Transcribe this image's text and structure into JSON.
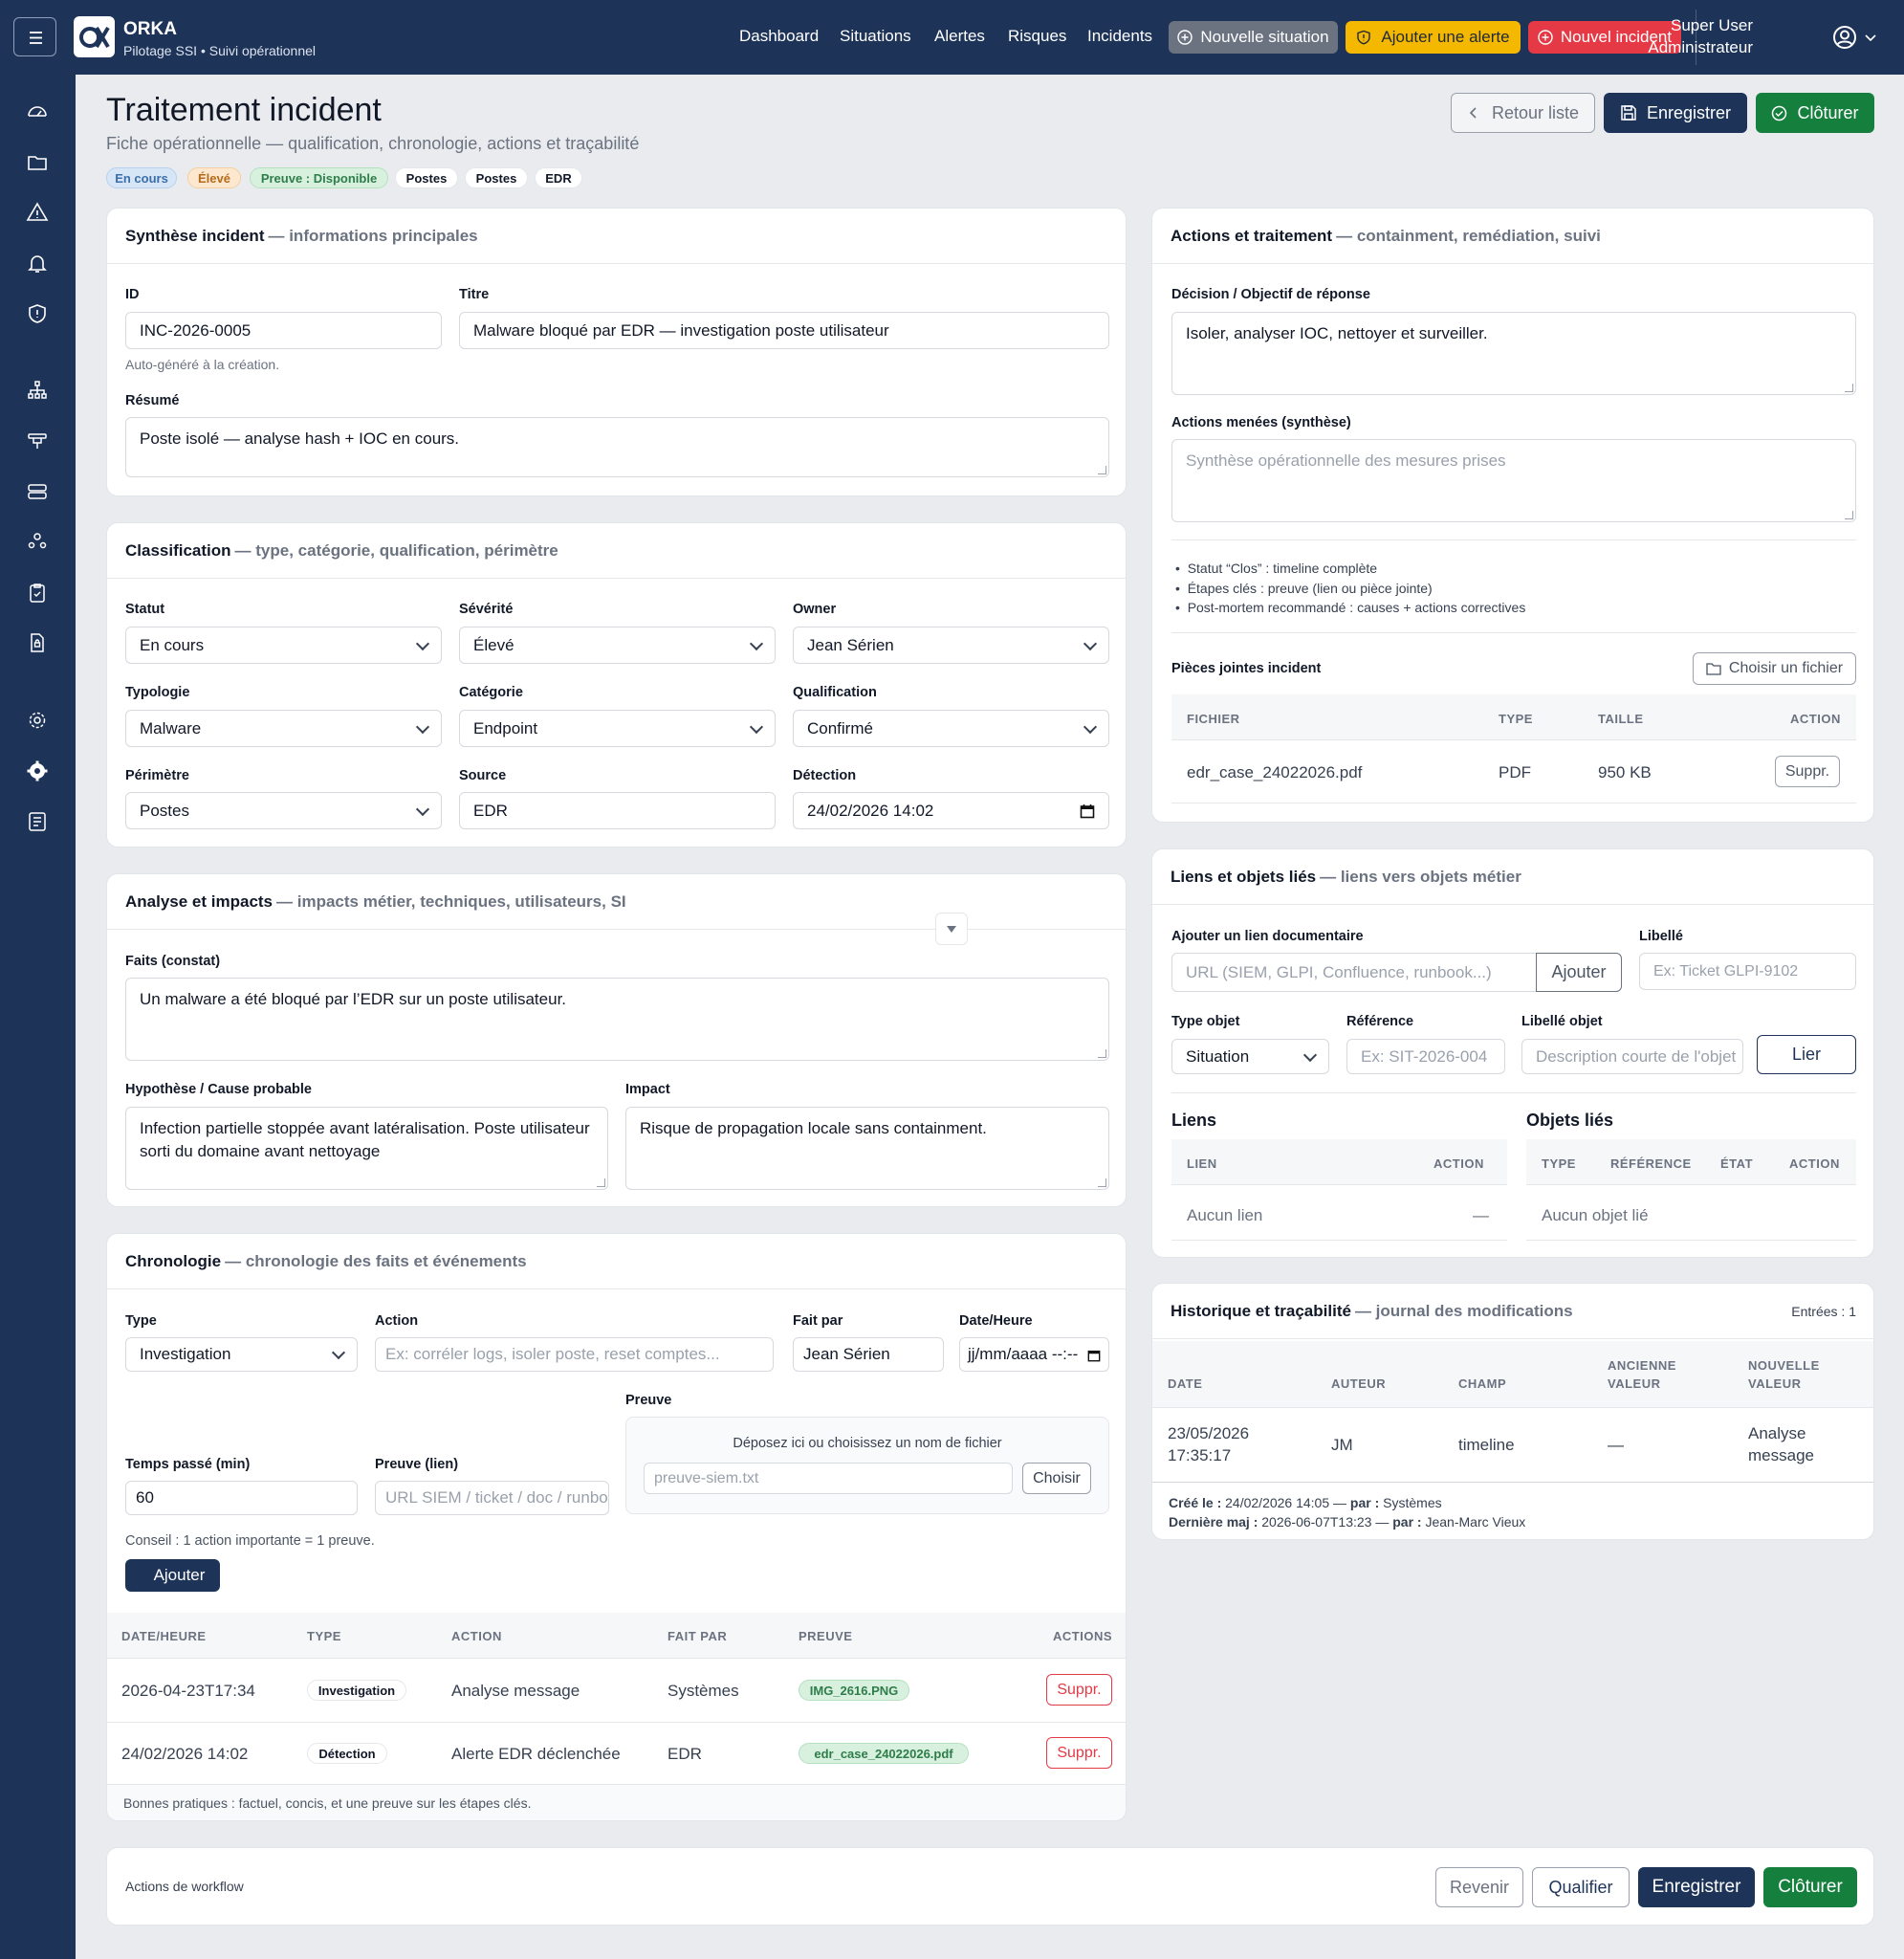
{
  "app": {
    "name": "ORKA",
    "tagline": "Pilotage SSI • Suivi opérationnel"
  },
  "nav": {
    "dashboard": "Dashboard",
    "situations": "Situations",
    "alertes": "Alertes",
    "risques": "Risques",
    "incidents": "Incidents"
  },
  "nav_actions": {
    "new_situation": "Nouvelle situation",
    "add_alert": "Ajouter une alerte",
    "new_incident": "Nouvel incident"
  },
  "user": {
    "name": "Super User",
    "role": "Administrateur"
  },
  "page": {
    "title": "Traitement incident",
    "subtitle": "Fiche opérationnelle — qualification, chronologie, actions et traçabilité",
    "back": "Retour liste",
    "save": "Enregistrer",
    "close": "Clôturer",
    "badges": [
      "En cours",
      "Élevé",
      "Preuve : Disponible",
      "Postes",
      "Postes",
      "EDR"
    ]
  },
  "synthese": {
    "title": "Synthèse incident",
    "sub": "— informations principales",
    "id_label": "ID",
    "id_value": "INC-2026-0005",
    "id_help": "Auto-généré à la création.",
    "title_label": "Titre",
    "title_value": "Malware bloqué par EDR — investigation poste utilisateur",
    "resume_label": "Résumé",
    "resume_value": "Poste isolé — analyse hash + IOC en cours."
  },
  "classification": {
    "title": "Classification",
    "sub": "— type, catégorie, qualification, périmètre",
    "statut_label": "Statut",
    "statut_value": "En cours",
    "severite_label": "Sévérité",
    "severite_value": "Élevé",
    "owner_label": "Owner",
    "owner_value": "Jean Sérien",
    "typologie_label": "Typologie",
    "typologie_value": "Malware",
    "categorie_label": "Catégorie",
    "categorie_value": "Endpoint",
    "qualification_label": "Qualification",
    "qualification_value": "Confirmé",
    "perimetre_label": "Périmètre",
    "perimetre_value": "Postes",
    "source_label": "Source",
    "source_value": "EDR",
    "detection_label": "Détection",
    "detection_value": "24/02/2026 14:02"
  },
  "analyse": {
    "title": "Analyse et impacts",
    "sub": "— impacts métier, techniques, utilisateurs, SI",
    "faits_label": "Faits (constat)",
    "faits_value": "Un malware a été bloqué par l’EDR sur un poste utilisateur.",
    "hypo_label": "Hypothèse / Cause probable",
    "hypo_line1": "Infection partielle stoppée avant latéralisation. Poste utilisateur",
    "hypo_line2": "sorti du domaine avant nettoyage",
    "impact_label": "Impact",
    "impact_value": "Risque de propagation locale sans containment."
  },
  "chrono": {
    "title": "Chronologie",
    "sub": "— chronologie des faits et événements",
    "type_label": "Type",
    "type_value": "Investigation",
    "action_label": "Action",
    "action_placeholder": "Ex: corréler logs, isoler poste, reset comptes...",
    "fait_par_label": "Fait par",
    "fait_par_value": "Jean Sérien",
    "date_label": "Date/Heure",
    "date_placeholder": "jj/mm/aaaa --:--",
    "preuve_label": "Preuve",
    "drop_text": "Déposez ici ou choisissez un nom de fichier",
    "drop_placeholder": "preuve-siem.txt",
    "choose": "Choisir",
    "temps_label": "Temps passé (min)",
    "temps_value": "60",
    "preuve_lien_label": "Preuve (lien)",
    "preuve_lien_placeholder": "URL SIEM / ticket / doc / runbook",
    "tip": "Conseil : 1 action importante = 1 preuve.",
    "add": "Ajouter",
    "columns": [
      "DATE/HEURE",
      "TYPE",
      "ACTION",
      "FAIT PAR",
      "PREUVE",
      "ACTIONS"
    ],
    "rows": [
      {
        "date": "2026-04-23T17:34",
        "type": "Investigation",
        "action": "Analyse message",
        "by": "Systèmes",
        "preuve": "IMG_2616.PNG",
        "del": "Suppr."
      },
      {
        "date": "24/02/2026 14:02",
        "type": "Détection",
        "action": "Alerte EDR déclenchée",
        "by": "EDR",
        "preuve": "edr_case_24022026.pdf",
        "del": "Suppr."
      }
    ],
    "footer": "Bonnes pratiques : factuel, concis, et une preuve sur les étapes clés."
  },
  "actions": {
    "title": "Actions et traitement",
    "sub": "— containment, remédiation, suivi",
    "decision_label": "Décision / Objectif de réponse",
    "decision_value": "Isoler, analyser IOC, nettoyer et surveiller.",
    "menees_label": "Actions menées (synthèse)",
    "menees_placeholder": "Synthèse opérationnelle des mesures prises",
    "bullets": [
      "Statut “Clos” : timeline complète",
      "Étapes clés : preuve (lien ou pièce jointe)",
      "Post-mortem recommandé : causes + actions correctives"
    ],
    "pj_label": "Pièces jointes incident",
    "choose_file": "Choisir un fichier",
    "columns": [
      "FICHIER",
      "TYPE",
      "TAILLE",
      "ACTION"
    ],
    "files": [
      {
        "name": "edr_case_24022026.pdf",
        "type": "PDF",
        "size": "950 KB",
        "del": "Suppr."
      }
    ]
  },
  "liens": {
    "title": "Liens et objets liés",
    "sub": "— liens vers objets métier",
    "add_label": "Ajouter un lien documentaire",
    "url_placeholder": "URL (SIEM, GLPI, Confluence, runbook...)",
    "add_btn": "Ajouter",
    "libelle_label": "Libellé",
    "libelle_placeholder": "Ex: Ticket GLPI-9102",
    "type_obj_label": "Type objet",
    "type_obj_value": "Situation",
    "ref_label": "Référence",
    "ref_placeholder": "Ex: SIT-2026-004",
    "lib_obj_label": "Libellé objet",
    "lib_obj_placeholder": "Description courte de l'objet",
    "lier": "Lier",
    "liens_title": "Liens",
    "liens_columns": [
      "LIEN",
      "ACTION"
    ],
    "liens_empty": "Aucun lien",
    "liens_empty_action": "—",
    "objets_title": "Objets liés",
    "objets_columns": [
      "TYPE",
      "RÉFÉRENCE",
      "ÉTAT",
      "ACTION"
    ],
    "objets_empty": "Aucun objet lié"
  },
  "historique": {
    "title": "Historique et traçabilité",
    "sub": "— journal des modifications",
    "count": "Entrées : 1",
    "columns": [
      "DATE",
      "AUTEUR",
      "CHAMP",
      "ANCIENNE",
      "VALEUR",
      "NOUVELLE",
      "VALEUR"
    ],
    "row": {
      "date1": "23/05/2026",
      "date2": "17:35:17",
      "author": "JM",
      "field": "timeline",
      "old": "—",
      "new1": "Analyse",
      "new2": "message"
    },
    "created_label": "Créé le :",
    "created_value": "24/02/2026 14:05 —",
    "created_by_label": "par :",
    "created_by": "Systèmes",
    "updated_label": "Dernière maj :",
    "updated_value": "2026-06-07T13:23 —",
    "updated_by_label": "par :",
    "updated_by": "Jean-Marc Vieux"
  },
  "workflow": {
    "label": "Actions de workflow",
    "revenir": "Revenir",
    "qualifier": "Qualifier",
    "save": "Enregistrer",
    "close": "Clôturer"
  },
  "colors": {
    "navy": "#1e3358",
    "green": "#15803d",
    "yellow": "#f5b800",
    "red": "#e53945"
  }
}
